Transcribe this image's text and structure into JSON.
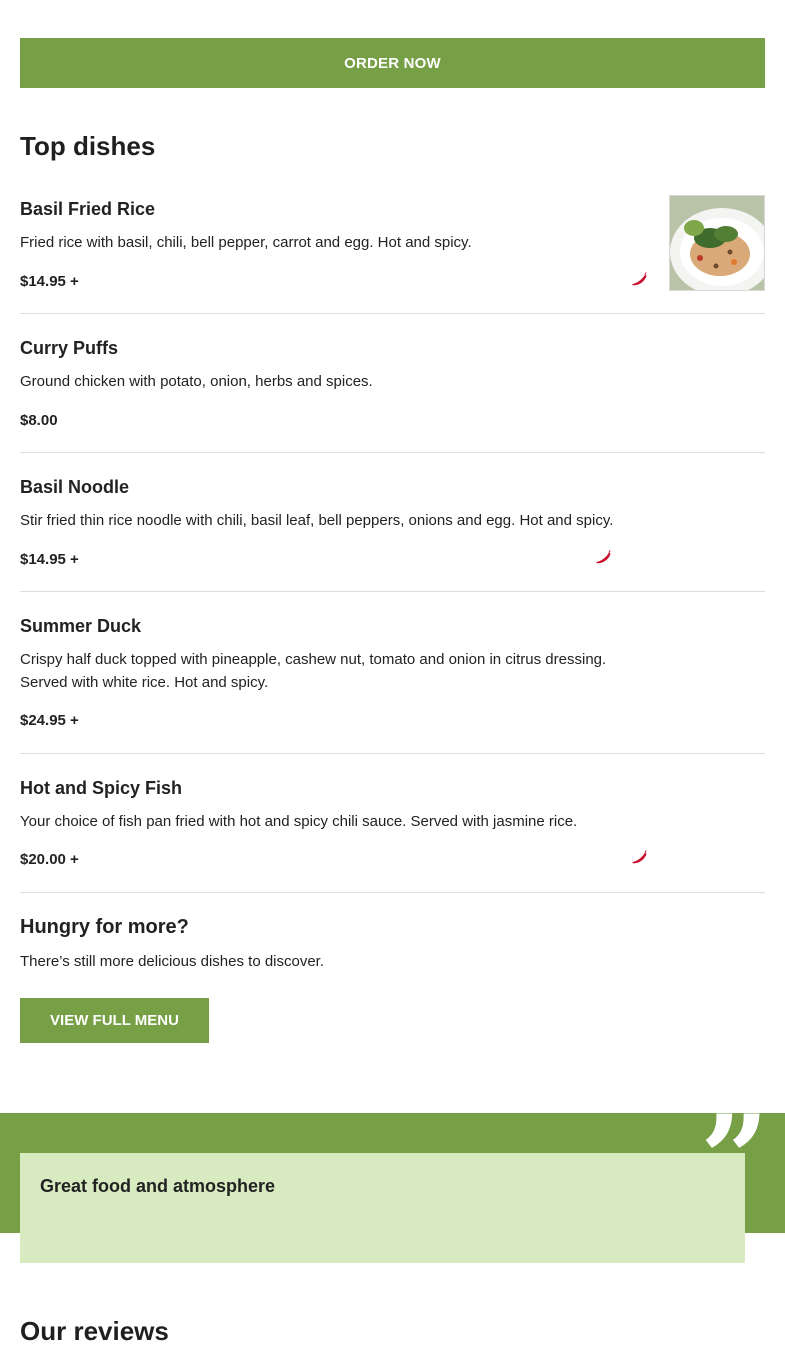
{
  "order": {
    "label": "ORDER NOW"
  },
  "top_dishes": {
    "title": "Top dishes",
    "items": [
      {
        "name": "Basil Fried Rice",
        "description": [
          "Fried rice with basil, chili, bell pepper, carrot and egg. Hot and spicy."
        ],
        "price": "$14.95 +",
        "spicy": true,
        "has_image": true
      },
      {
        "name": "Curry Puffs",
        "description": [
          "Ground chicken with potato, onion, herbs and spices."
        ],
        "price": "$8.00",
        "spicy": false,
        "has_image": false
      },
      {
        "name": "Basil Noodle",
        "description": [
          "Stir fried thin rice noodle with chili, basil leaf, bell peppers, onions and egg. Hot and spicy."
        ],
        "price": "$14.95 +",
        "spicy": true,
        "has_image": false
      },
      {
        "name": "Summer Duck",
        "description": [
          "Crispy half duck topped with pineapple, cashew nut, tomato and onion in citrus dressing.",
          "Served with white rice. Hot and spicy."
        ],
        "price": "$24.95 +",
        "spicy": false,
        "has_image": false
      },
      {
        "name": "Hot and Spicy Fish",
        "description": [
          "Your choice of fish pan fried with hot and spicy chili sauce. Served with jasmine rice."
        ],
        "price": "$20.00 +",
        "spicy": true,
        "has_image": false
      }
    ]
  },
  "more": {
    "title": "Hungry for more?",
    "text": "There’s still more delicious dishes to discover.",
    "button_label": "VIEW FULL MENU"
  },
  "review": {
    "title": "Great food and atmosphere",
    "quote_glyph": "”"
  },
  "reviews_section": {
    "title": "Our reviews"
  },
  "colors": {
    "accent": "#769f46",
    "card": "#d7eac0",
    "chili": "#c8102e"
  },
  "icons": {
    "spicy": "chili-pepper-icon",
    "quote": "quote-icon"
  }
}
